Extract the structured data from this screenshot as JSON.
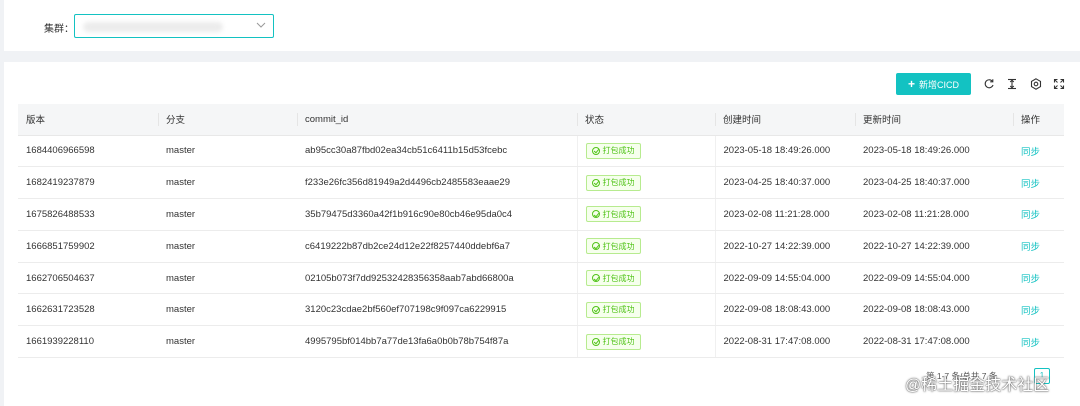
{
  "filter": {
    "label": "集群：",
    "selected_value": ""
  },
  "toolbar": {
    "add_label": "新增CICD",
    "accent_color": "#13c2c2",
    "icons": [
      "refresh-icon",
      "column-height-icon",
      "settings-icon",
      "fullscreen-icon"
    ]
  },
  "table": {
    "headers": [
      "版本",
      "分支",
      "commit_id",
      "状态",
      "创建时间",
      "更新时间",
      "操作"
    ],
    "rows": [
      {
        "version": "1684406966598",
        "branch": "master",
        "commit_id": "ab95cc30a87fbd02ea34cb51c6411b15d53fcebc",
        "status": "打包成功",
        "created": "2023-05-18 18:49:26.000",
        "updated": "2023-05-18 18:49:26.000",
        "action": "同步"
      },
      {
        "version": "1682419237879",
        "branch": "master",
        "commit_id": "f233e26fc356d81949a2d4496cb2485583eaae29",
        "status": "打包成功",
        "created": "2023-04-25 18:40:37.000",
        "updated": "2023-04-25 18:40:37.000",
        "action": "同步"
      },
      {
        "version": "1675826488533",
        "branch": "master",
        "commit_id": "35b79475d3360a42f1b916c90e80cb46e95da0c4",
        "status": "打包成功",
        "created": "2023-02-08 11:21:28.000",
        "updated": "2023-02-08 11:21:28.000",
        "action": "同步"
      },
      {
        "version": "1666851759902",
        "branch": "master",
        "commit_id": "c6419222b87db2ce24d12e22f8257440ddebf6a7",
        "status": "打包成功",
        "created": "2022-10-27 14:22:39.000",
        "updated": "2022-10-27 14:22:39.000",
        "action": "同步"
      },
      {
        "version": "1662706504637",
        "branch": "master",
        "commit_id": "02105b073f7dd92532428356358aab7abd66800a",
        "status": "打包成功",
        "created": "2022-09-09 14:55:04.000",
        "updated": "2022-09-09 14:55:04.000",
        "action": "同步"
      },
      {
        "version": "1662631723528",
        "branch": "master",
        "commit_id": "3120c23cdae2bf560ef707198c9f097ca6229915",
        "status": "打包成功",
        "created": "2022-09-08 18:08:43.000",
        "updated": "2022-09-08 18:08:43.000",
        "action": "同步"
      },
      {
        "version": "1661939228110",
        "branch": "master",
        "commit_id": "4995795bf014bb7a77de13fa6a0b0b78b754f87a",
        "status": "打包成功",
        "created": "2022-08-31 17:47:08.000",
        "updated": "2022-08-31 17:47:08.000",
        "action": "同步"
      }
    ]
  },
  "pagination": {
    "summary": "第 1-7 条/总共 7 条",
    "current_page": "1"
  },
  "watermark": "@稀土掘金技术社区",
  "colors": {
    "success_text": "#52c41a",
    "success_bg": "#f6ffed",
    "success_border": "#b7eb8f"
  }
}
